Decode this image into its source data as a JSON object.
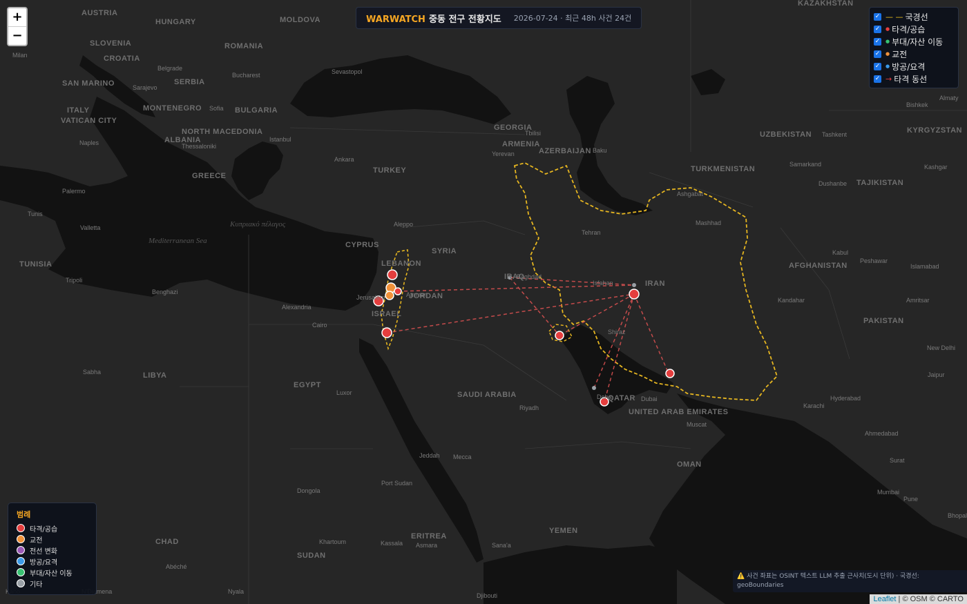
{
  "header": {
    "brand": "WARWATCH",
    "title": "중동 전구 전황지도",
    "meta": "2026-07-24 · 최근 48h 사건 24건"
  },
  "zoom": {
    "in_label": "+",
    "out_label": "−"
  },
  "layers": [
    {
      "symbol": "— —",
      "label": "국경선",
      "color": "#f5c518",
      "checked": true
    },
    {
      "symbol": "●",
      "label": "타격/공습",
      "color": "#e53e3e",
      "checked": true
    },
    {
      "symbol": "●",
      "label": "부대/자산 이동",
      "color": "#38c172",
      "checked": true
    },
    {
      "symbol": "●",
      "label": "교전",
      "color": "#f0913a",
      "checked": true
    },
    {
      "symbol": "●",
      "label": "방공/요격",
      "color": "#3b9ae8",
      "checked": true
    },
    {
      "symbol": "→",
      "label": "타격 동선",
      "color": "#e53e3e",
      "checked": true
    }
  ],
  "legend": {
    "title": "범례",
    "items": [
      {
        "label": "타격/공습",
        "color": "#e53e3e"
      },
      {
        "label": "교전",
        "color": "#f0913a"
      },
      {
        "label": "전선 변화",
        "color": "#9b59b6"
      },
      {
        "label": "방공/요격",
        "color": "#3b9ae8"
      },
      {
        "label": "부대/자산 이동",
        "color": "#38c172"
      },
      {
        "label": "기타",
        "color": "#9aa0a6"
      }
    ]
  },
  "disclaimer": "⚠️ 사건 좌표는 OSINT 텍스트 LLM 추출 근사치(도시 단위) · 국경선: geoBoundaries",
  "attribution": {
    "leaflet": "Leaflet",
    "rest": " | © OSM © CARTO"
  },
  "map_labels": {
    "countries": [
      "AUSTRIA",
      "HUNGARY",
      "MOLDOVA",
      "ROMANIA",
      "SLOVENIA",
      "CROATIA",
      "SERBIA",
      "ITALY",
      "SAN MARINO",
      "VATICAN CITY",
      "MONTENEGRO",
      "BULGARIA",
      "NORTH MACEDONIA",
      "ALBANIA",
      "GREECE",
      "TURKEY",
      "GEORGIA",
      "ARMENIA",
      "AZERBAIJAN",
      "KAZAKHSTAN",
      "UZBEKISTAN",
      "KYRGYZSTAN",
      "TURKMENISTAN",
      "TAJIKISTAN",
      "AFGHANISTAN",
      "PAKISTAN",
      "IRAN",
      "IRAQ",
      "SYRIA",
      "LEBANON",
      "CYPRUS",
      "ISRAEL",
      "JORDAN",
      "EGYPT",
      "LIBYA",
      "TUNISIA",
      "SAUDI ARABIA",
      "QATAR",
      "UNITED ARAB EMIRATES",
      "OMAN",
      "YEMEN",
      "ERITREA",
      "SUDAN",
      "CHAD"
    ],
    "cities": [
      "Milan",
      "Belgrade",
      "Bucharest",
      "Sarajevo",
      "Sofia",
      "Naples",
      "Thessaloniki",
      "Istanbul",
      "Ankara",
      "Sevastopol",
      "Tbilisi",
      "Yerevan",
      "Baku",
      "Tehran",
      "Mashhad",
      "Ashgabat",
      "Tashkent",
      "Bishkek",
      "Almaty",
      "Samarkand",
      "Dushanbe",
      "Kabul",
      "Kashgar",
      "Peshawar",
      "Islamabad",
      "Kandahar",
      "Amritsar",
      "New Delhi",
      "Jaipur",
      "Hyderabad",
      "Karachi",
      "Ahmedabad",
      "Surat",
      "Mumbai",
      "Pune",
      "Aleppo",
      "Baghdad",
      "Isfahan",
      "Shiraz",
      "Jerusalem",
      "Amman",
      "Alexandria",
      "Cairo",
      "Luxor",
      "Tripoli",
      "Benghazi",
      "Valletta",
      "Palermo",
      "Tunis",
      "Sabha",
      "Jeddah",
      "Mecca",
      "Riyadh",
      "Dubai",
      "Muscat",
      "Doha",
      "Port Sudan",
      "Dongola",
      "Khartoum",
      "Kassala",
      "Asmara",
      "Sana'a",
      "Abéché",
      "Djibouti",
      "Kano",
      "N'Djamena",
      "Nyala",
      "Bhopal"
    ],
    "seas": [
      "Mediterranean Sea",
      "Κυπριακό πέλαγος"
    ]
  }
}
